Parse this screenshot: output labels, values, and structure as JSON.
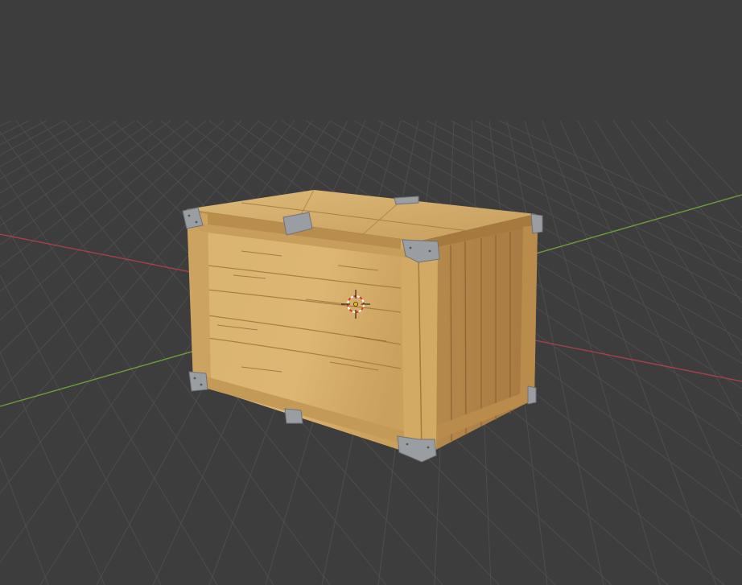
{
  "viewport": {
    "background": "#3d3d3d",
    "grid_color": "#4d4d4d",
    "x_axis_color": "#a3424b",
    "y_axis_color": "#6d9a3a"
  },
  "scene": {
    "object": "wooden-crate",
    "wood_light": "#d7b06b",
    "wood_mid": "#c39a57",
    "wood_dark": "#9d733b",
    "metal_color": "#9a9da2"
  },
  "cursor": {
    "icon": "3d-cursor-icon",
    "ring_colors": [
      "#d43a2e",
      "#f2f2f2"
    ]
  }
}
